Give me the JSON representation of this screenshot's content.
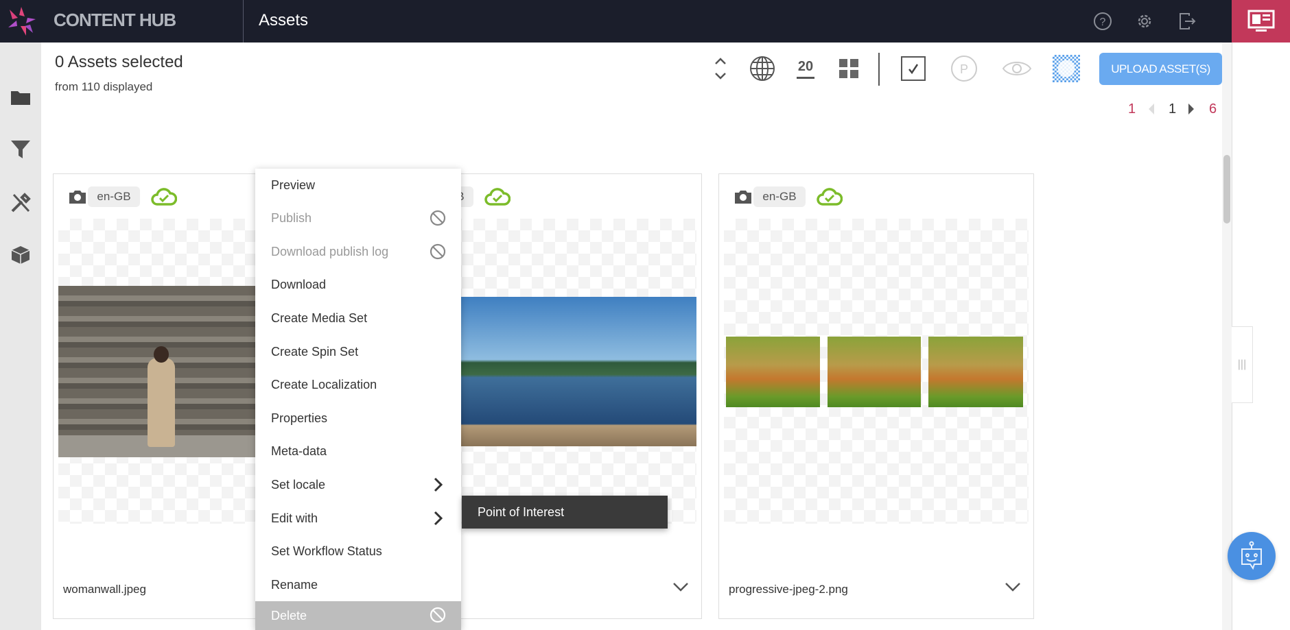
{
  "header": {
    "brand": "CONTENT HUB",
    "title": "Assets",
    "icons": [
      "logo-icon",
      "help-icon",
      "gear-icon",
      "logout-icon",
      "monitor-icon"
    ],
    "accent": "#c2385a"
  },
  "sidebar": {
    "icons": [
      "folder-icon",
      "filter-icon",
      "tools-icon",
      "box-icon"
    ]
  },
  "selection": {
    "count": "0 Assets selected",
    "displayed": "from 110 displayed"
  },
  "toolbar": {
    "page_size": "20",
    "upload_label": "UPLOAD ASSET(S)",
    "upload_color": "#6aaaf0"
  },
  "pagination": {
    "first": "1",
    "current": "1",
    "last": "6"
  },
  "cards": [
    {
      "locale": "en-GB",
      "filename": "womanwall.jpeg"
    },
    {
      "locale": "en-GB",
      "filename": ""
    },
    {
      "locale": "en-GB",
      "filename": "progressive-jpeg-2.png"
    }
  ],
  "context_menu": {
    "items": [
      {
        "label": "Preview",
        "disabled": false
      },
      {
        "label": "Publish",
        "disabled": true
      },
      {
        "label": "Download publish log",
        "disabled": true
      },
      {
        "label": "Download",
        "disabled": false
      },
      {
        "label": "Create Media Set",
        "disabled": false
      },
      {
        "label": "Create Spin Set",
        "disabled": false
      },
      {
        "label": "Create Localization",
        "disabled": false
      },
      {
        "label": "Properties",
        "disabled": false
      },
      {
        "label": "Meta-data",
        "disabled": false
      },
      {
        "label": "Set locale",
        "submenu": true
      },
      {
        "label": "Edit with",
        "submenu": true
      },
      {
        "label": "Set Workflow Status",
        "disabled": false
      },
      {
        "label": "Rename",
        "disabled": false
      },
      {
        "label": "Delete",
        "disabled": true,
        "highlighted": true
      }
    ],
    "submenu": {
      "label": "Point of Interest"
    }
  }
}
